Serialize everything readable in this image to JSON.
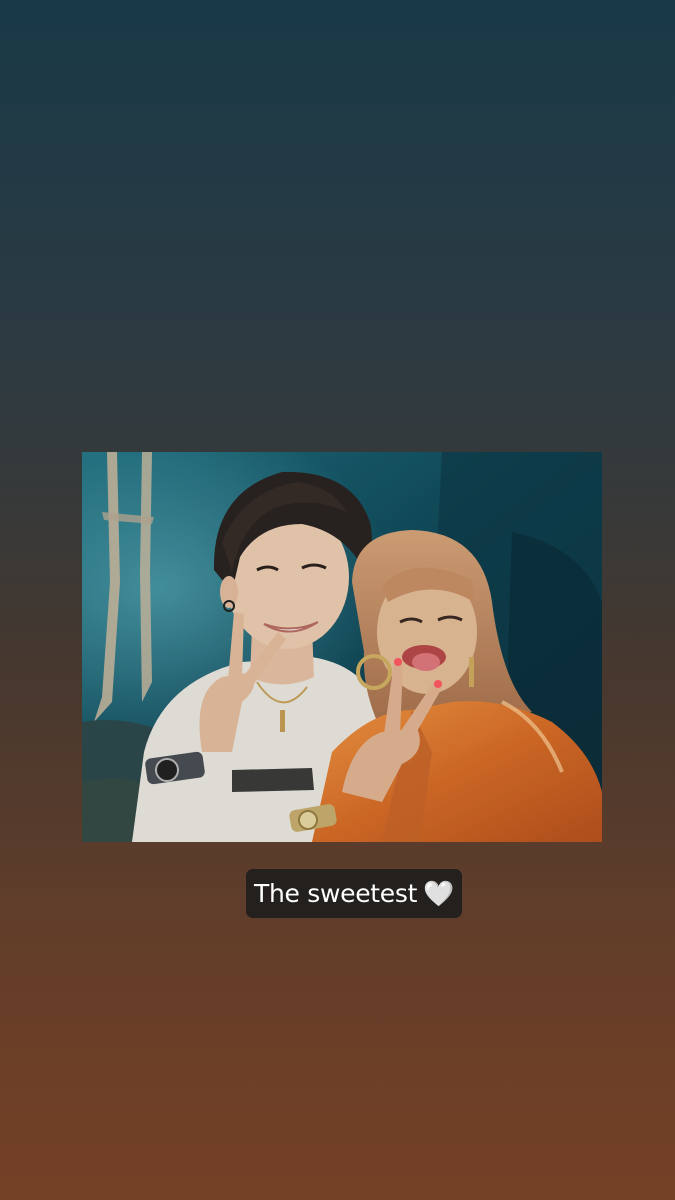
{
  "story": {
    "caption": {
      "text": "The sweetest",
      "emoji": "🤍",
      "emoji_name": "white-heart-icon"
    },
    "photo": {
      "content": "selfie-photo"
    },
    "colors": {
      "gradient_top": "#193947",
      "gradient_bottom": "#744126",
      "caption_background": "#24201d",
      "caption_text": "#ffffff"
    }
  }
}
